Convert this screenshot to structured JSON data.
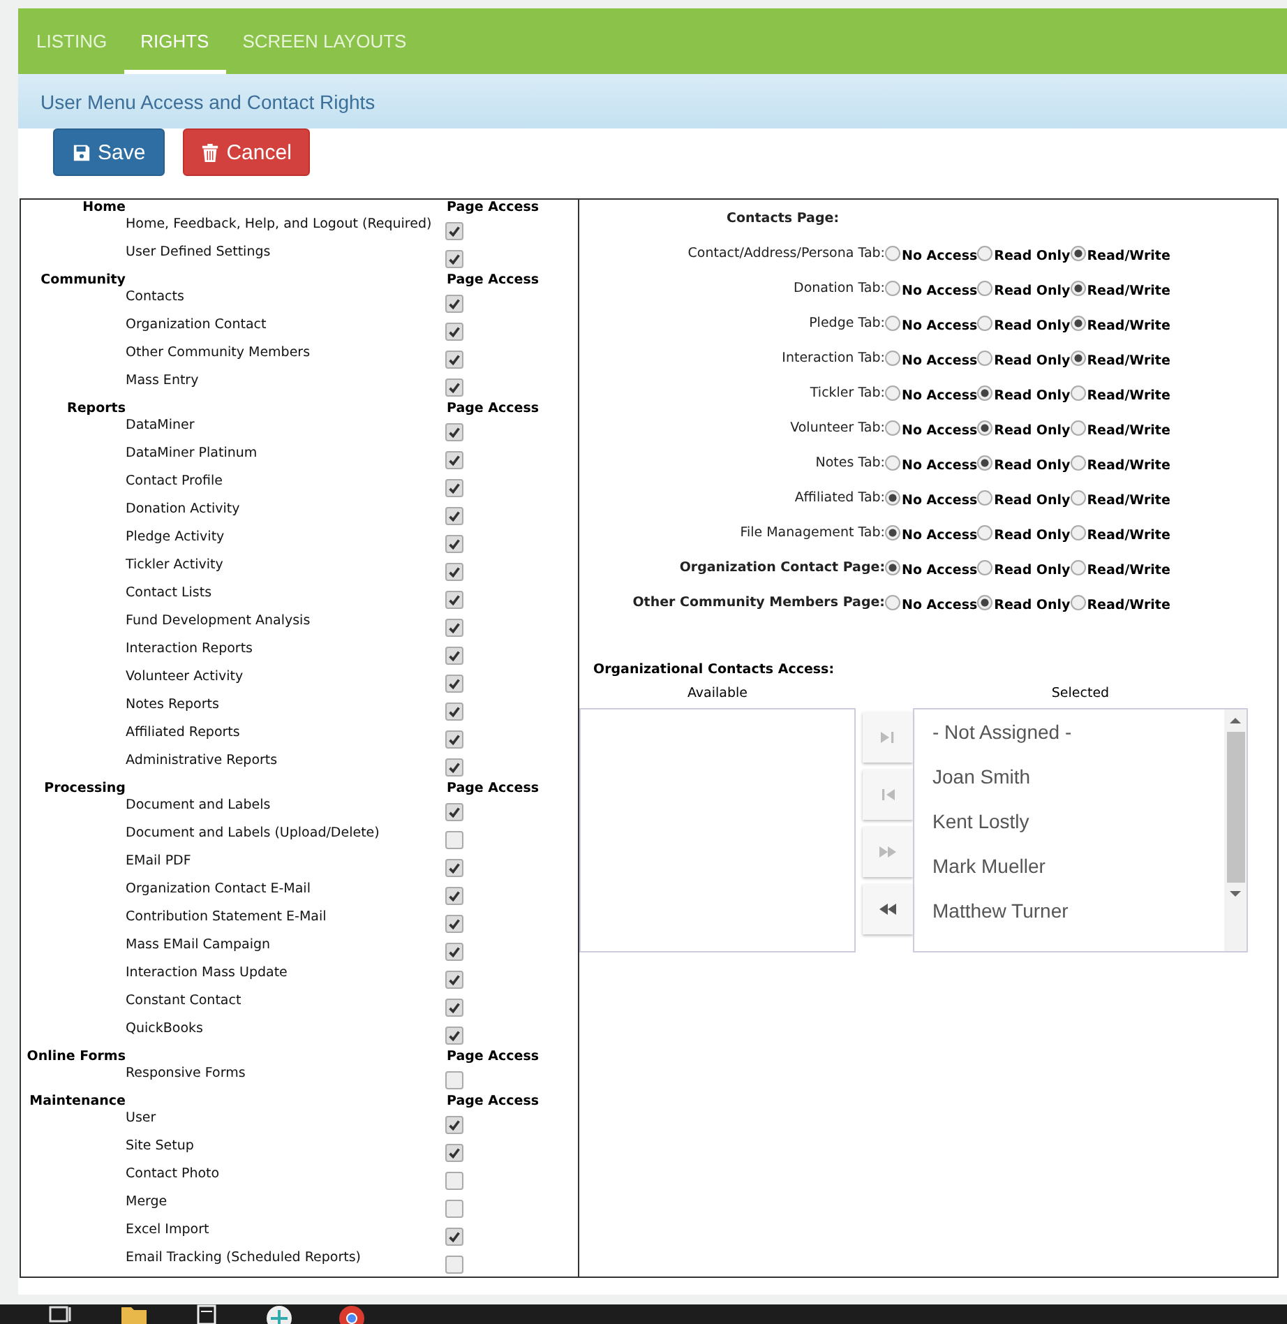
{
  "tabs": [
    {
      "label": "LISTING",
      "selected": false
    },
    {
      "label": "RIGHTS",
      "selected": true
    },
    {
      "label": "SCREEN LAYOUTS",
      "selected": false
    }
  ],
  "subtitle": "User Menu Access and Contact Rights",
  "buttons": [
    {
      "label": "Save",
      "kind": "save"
    },
    {
      "label": "Cancel",
      "kind": "cancel"
    }
  ],
  "menu_sections": [
    {
      "title": "Home",
      "column": "Page Access",
      "items": [
        {
          "label": "Home, Feedback, Help, and Logout (Required)",
          "checked": true
        },
        {
          "label": "User Defined Settings",
          "checked": true
        }
      ]
    },
    {
      "title": "Community",
      "column": "Page Access",
      "items": [
        {
          "label": "Contacts",
          "checked": true
        },
        {
          "label": "Organization Contact",
          "checked": true
        },
        {
          "label": "Other Community Members",
          "checked": true
        },
        {
          "label": "Mass Entry",
          "checked": true
        }
      ]
    },
    {
      "title": "Reports",
      "column": "Page Access",
      "items": [
        {
          "label": "DataMiner",
          "checked": true
        },
        {
          "label": "DataMiner Platinum",
          "checked": true
        },
        {
          "label": "Contact Profile",
          "checked": true
        },
        {
          "label": "Donation Activity",
          "checked": true
        },
        {
          "label": "Pledge Activity",
          "checked": true
        },
        {
          "label": "Tickler Activity",
          "checked": true
        },
        {
          "label": "Contact Lists",
          "checked": true
        },
        {
          "label": "Fund Development Analysis",
          "checked": true
        },
        {
          "label": "Interaction Reports",
          "checked": true
        },
        {
          "label": "Volunteer Activity",
          "checked": true
        },
        {
          "label": "Notes Reports",
          "checked": true
        },
        {
          "label": "Affiliated Reports",
          "checked": true
        },
        {
          "label": "Administrative Reports",
          "checked": true
        }
      ]
    },
    {
      "title": "Processing",
      "column": "Page Access",
      "items": [
        {
          "label": "Document and Labels",
          "checked": true
        },
        {
          "label": "Document and Labels (Upload/Delete)",
          "checked": false
        },
        {
          "label": "EMail PDF",
          "checked": true
        },
        {
          "label": "Organization Contact E-Mail",
          "checked": true
        },
        {
          "label": "Contribution Statement E-Mail",
          "checked": true
        },
        {
          "label": "Mass EMail Campaign",
          "checked": true
        },
        {
          "label": "Interaction Mass Update",
          "checked": true
        },
        {
          "label": "Constant Contact",
          "checked": true
        },
        {
          "label": "QuickBooks",
          "checked": true
        }
      ]
    },
    {
      "title": "Online Forms",
      "column": "Page Access",
      "items": [
        {
          "label": "Responsive Forms",
          "checked": false
        }
      ]
    },
    {
      "title": "Maintenance",
      "column": "Page Access",
      "items": [
        {
          "label": "User",
          "checked": true
        },
        {
          "label": "Site Setup",
          "checked": true
        },
        {
          "label": "Contact Photo",
          "checked": false
        },
        {
          "label": "Merge",
          "checked": false
        },
        {
          "label": "Excel Import",
          "checked": true
        },
        {
          "label": "Email Tracking (Scheduled Reports)",
          "checked": false
        }
      ]
    }
  ],
  "contacts_heading": "Contacts Page:",
  "access_rows": [
    {
      "label": "Contact/Address/Persona Tab:",
      "kind": "tab",
      "options": [
        {
          "label": "No Access",
          "selected": false
        },
        {
          "label": "Read Only",
          "selected": false
        },
        {
          "label": "Read/Write",
          "selected": true
        }
      ]
    },
    {
      "label": "Donation Tab:",
      "kind": "tab",
      "options": [
        {
          "label": "No Access",
          "selected": false
        },
        {
          "label": "Read Only",
          "selected": false
        },
        {
          "label": "Read/Write",
          "selected": true
        }
      ]
    },
    {
      "label": "Pledge Tab:",
      "kind": "tab",
      "options": [
        {
          "label": "No Access",
          "selected": false
        },
        {
          "label": "Read Only",
          "selected": false
        },
        {
          "label": "Read/Write",
          "selected": true
        }
      ]
    },
    {
      "label": "Interaction Tab:",
      "kind": "tab",
      "options": [
        {
          "label": "No Access",
          "selected": false
        },
        {
          "label": "Read Only",
          "selected": false
        },
        {
          "label": "Read/Write",
          "selected": true
        }
      ]
    },
    {
      "label": "Tickler Tab:",
      "kind": "tab",
      "options": [
        {
          "label": "No Access",
          "selected": false
        },
        {
          "label": "Read Only",
          "selected": true
        },
        {
          "label": "Read/Write",
          "selected": false
        }
      ]
    },
    {
      "label": "Volunteer Tab:",
      "kind": "tab",
      "options": [
        {
          "label": "No Access",
          "selected": false
        },
        {
          "label": "Read Only",
          "selected": true
        },
        {
          "label": "Read/Write",
          "selected": false
        }
      ]
    },
    {
      "label": "Notes Tab:",
      "kind": "tab",
      "options": [
        {
          "label": "No Access",
          "selected": false
        },
        {
          "label": "Read Only",
          "selected": true
        },
        {
          "label": "Read/Write",
          "selected": false
        }
      ]
    },
    {
      "label": "Affiliated Tab:",
      "kind": "tab",
      "options": [
        {
          "label": "No Access",
          "selected": true
        },
        {
          "label": "Read Only",
          "selected": false
        },
        {
          "label": "Read/Write",
          "selected": false
        }
      ]
    },
    {
      "label": "File Management Tab:",
      "kind": "tab",
      "options": [
        {
          "label": "No Access",
          "selected": true
        },
        {
          "label": "Read Only",
          "selected": false
        },
        {
          "label": "Read/Write",
          "selected": false
        }
      ]
    },
    {
      "label": "Organization Contact Page:",
      "kind": "page",
      "options": [
        {
          "label": "No Access",
          "selected": true
        },
        {
          "label": "Read Only",
          "selected": false
        },
        {
          "label": "Read/Write",
          "selected": false
        }
      ]
    },
    {
      "label": "Other Community Members Page:",
      "kind": "page",
      "options": [
        {
          "label": "No Access",
          "selected": false
        },
        {
          "label": "Read Only",
          "selected": true
        },
        {
          "label": "Read/Write",
          "selected": false
        }
      ]
    }
  ],
  "org_access": {
    "title": "Organizational Contacts Access:",
    "available_label": "Available",
    "selected_label": "Selected",
    "movers": [
      {
        "kind": "move-one",
        "disabled": true
      },
      {
        "kind": "remove-one",
        "disabled": true
      },
      {
        "kind": "move-all",
        "disabled": true
      },
      {
        "kind": "remove-all",
        "disabled": false
      }
    ],
    "selected_items": [
      "- Not Assigned -",
      "Joan Smith",
      "Kent Lostly",
      "Mark Mueller",
      "Matthew Turner"
    ]
  }
}
